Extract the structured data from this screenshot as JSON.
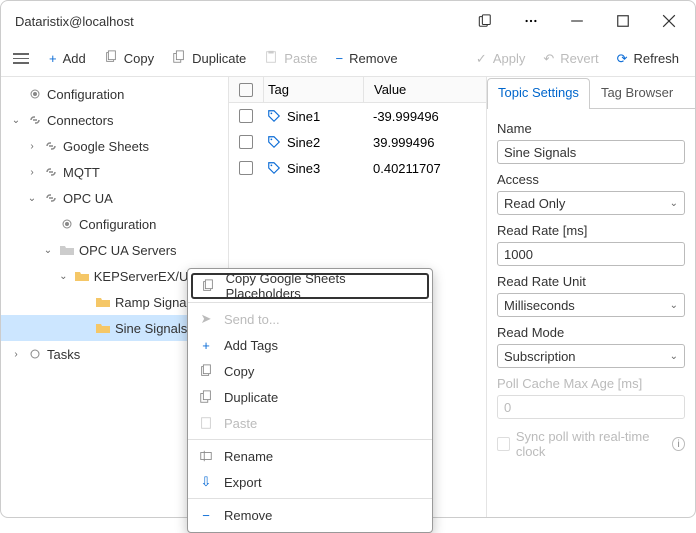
{
  "window": {
    "title": "Dataristix@localhost"
  },
  "toolbar": {
    "add": "Add",
    "copy": "Copy",
    "duplicate": "Duplicate",
    "paste": "Paste",
    "remove": "Remove",
    "apply": "Apply",
    "revert": "Revert",
    "refresh": "Refresh"
  },
  "tree": {
    "configuration": "Configuration",
    "connectors": "Connectors",
    "google_sheets": "Google Sheets",
    "mqtt": "MQTT",
    "opc_ua": "OPC UA",
    "opc_ua_conf": "Configuration",
    "opc_ua_servers": "OPC UA Servers",
    "kepserver": "KEPServerEX/UA@Te...",
    "ramp": "Ramp Signals",
    "sine": "Sine Signals",
    "tasks": "Tasks"
  },
  "table": {
    "head_tag": "Tag",
    "head_val": "Value",
    "rows": [
      {
        "tag": "Sine1",
        "val": "-39.999496"
      },
      {
        "tag": "Sine2",
        "val": "39.999496"
      },
      {
        "tag": "Sine3",
        "val": "0.40211707"
      }
    ]
  },
  "tabs": {
    "topic": "Topic Settings",
    "browser": "Tag Browser"
  },
  "props": {
    "name_lbl": "Name",
    "name_val": "Sine Signals",
    "access_lbl": "Access",
    "access_val": "Read Only",
    "rate_lbl": "Read Rate [ms]",
    "rate_val": "1000",
    "unit_lbl": "Read Rate Unit",
    "unit_val": "Milliseconds",
    "mode_lbl": "Read Mode",
    "mode_val": "Subscription",
    "poll_lbl": "Poll Cache Max Age [ms]",
    "poll_val": "0",
    "sync_lbl": "Sync poll with real-time clock"
  },
  "ctx": {
    "copy_gs": "Copy Google Sheets Placeholders",
    "send": "Send to...",
    "add_tags": "Add Tags",
    "copy": "Copy",
    "duplicate": "Duplicate",
    "paste": "Paste",
    "rename": "Rename",
    "export": "Export",
    "remove": "Remove"
  }
}
